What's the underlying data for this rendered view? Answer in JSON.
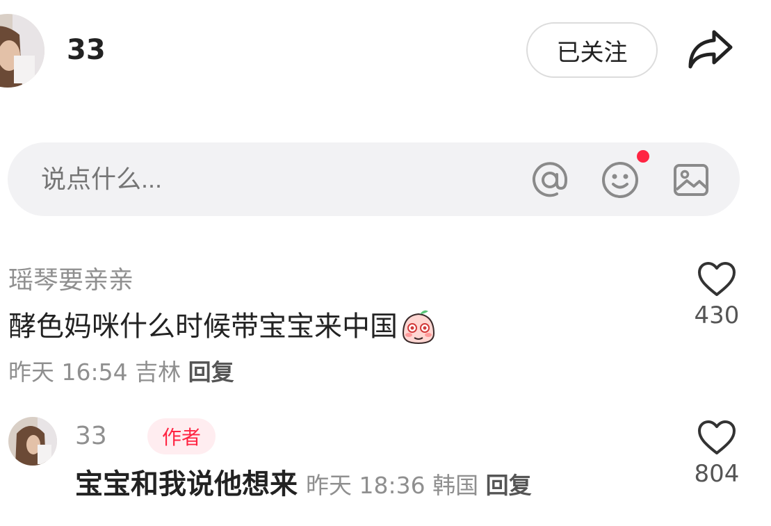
{
  "header": {
    "author_name": "33",
    "follow_label": "已关注",
    "share_icon": "share-arrow-icon"
  },
  "comment_box": {
    "placeholder": "说点什么...",
    "icons": [
      "at-icon",
      "emoji-icon",
      "image-icon"
    ],
    "emoji_notification_dot": true
  },
  "comments": [
    {
      "user": "瑶琴要亲亲",
      "text": "酵色妈咪什么时候带宝宝来中国",
      "sticker": "shy-peach-sticker",
      "time": "昨天 16:54",
      "location": "吉林",
      "reply_label": "回复",
      "likes": "430"
    },
    {
      "user": "33",
      "badge": "作者",
      "text": "宝宝和我说他想来",
      "time": "昨天 18:36",
      "location": "韩国",
      "reply_label": "回复",
      "likes": "804"
    }
  ],
  "colors": {
    "accent": "#ff2442",
    "muted_text": "#8f8f8f",
    "input_bg": "#f2f2f4"
  }
}
